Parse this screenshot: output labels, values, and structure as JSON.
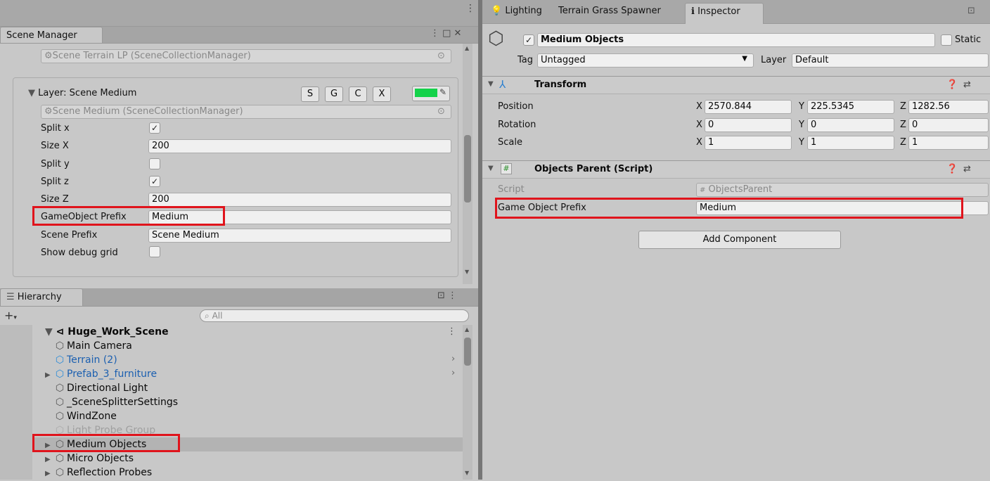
{
  "scene_manager": {
    "tab": "Scene Manager",
    "collection_top": "Scene Terrain LP (SceneCollectionManager)",
    "layer_title": "Layer: Scene Medium",
    "layer_buttons": [
      "S",
      "G",
      "C",
      "X"
    ],
    "layer_color": "#14d24a",
    "collection": "Scene Medium (SceneCollectionManager)",
    "fields": {
      "split_x": {
        "label": "Split x",
        "checked": "✓"
      },
      "size_x": {
        "label": "Size X",
        "value": "200"
      },
      "split_y": {
        "label": "Split y",
        "checked": ""
      },
      "split_z": {
        "label": "Split z",
        "checked": "✓"
      },
      "size_z": {
        "label": "Size Z",
        "value": "200"
      },
      "go_prefix": {
        "label": "GameObject Prefix",
        "value": "Medium"
      },
      "scene_prefix": {
        "label": "Scene Prefix",
        "value": "Scene Medium"
      },
      "debug_grid": {
        "label": "Show debug grid",
        "checked": ""
      }
    }
  },
  "hierarchy": {
    "tab": "Hierarchy",
    "search_placeholder": "All",
    "add": "+",
    "scene": "Huge_Work_Scene",
    "items": [
      {
        "label": "Main Camera",
        "arrow": "",
        "prefab": false,
        "muted": false
      },
      {
        "label": "Terrain (2)",
        "arrow": "",
        "prefab": true,
        "muted": false
      },
      {
        "label": "Prefab_3_furniture",
        "arrow": "▶",
        "prefab": true,
        "muted": false
      },
      {
        "label": "Directional Light",
        "arrow": "",
        "prefab": false,
        "muted": false
      },
      {
        "label": "_SceneSplitterSettings",
        "arrow": "",
        "prefab": false,
        "muted": false
      },
      {
        "label": "WindZone",
        "arrow": "",
        "prefab": false,
        "muted": false
      },
      {
        "label": "Light Probe Group",
        "arrow": "",
        "prefab": false,
        "muted": true
      },
      {
        "label": "Medium Objects",
        "arrow": "▶",
        "prefab": false,
        "muted": false
      },
      {
        "label": "Micro Objects",
        "arrow": "▶",
        "prefab": false,
        "muted": false
      },
      {
        "label": "Reflection Probes",
        "arrow": "▶",
        "prefab": false,
        "muted": false
      }
    ]
  },
  "tabs_right": [
    "Lighting",
    "Terrain Grass Spawner",
    "Inspector"
  ],
  "inspector": {
    "object_name": "Medium Objects",
    "enabled": "✓",
    "static_label": "Static",
    "tag_label": "Tag",
    "tag_value": "Untagged",
    "layer_label": "Layer",
    "layer_value": "Default",
    "transform": {
      "title": "Transform",
      "position": {
        "label": "Position",
        "x": "2570.844",
        "y": "225.5345",
        "z": "1282.56"
      },
      "rotation": {
        "label": "Rotation",
        "x": "0",
        "y": "0",
        "z": "0"
      },
      "scale": {
        "label": "Scale",
        "x": "1",
        "y": "1",
        "z": "1"
      }
    },
    "script_component": {
      "title": "Objects Parent (Script)",
      "script_label": "Script",
      "script_value": "ObjectsParent",
      "prefix_label": "Game Object Prefix",
      "prefix_value": "Medium"
    },
    "add_component": "Add Component",
    "axis": {
      "x": "X",
      "y": "Y",
      "z": "Z"
    }
  }
}
